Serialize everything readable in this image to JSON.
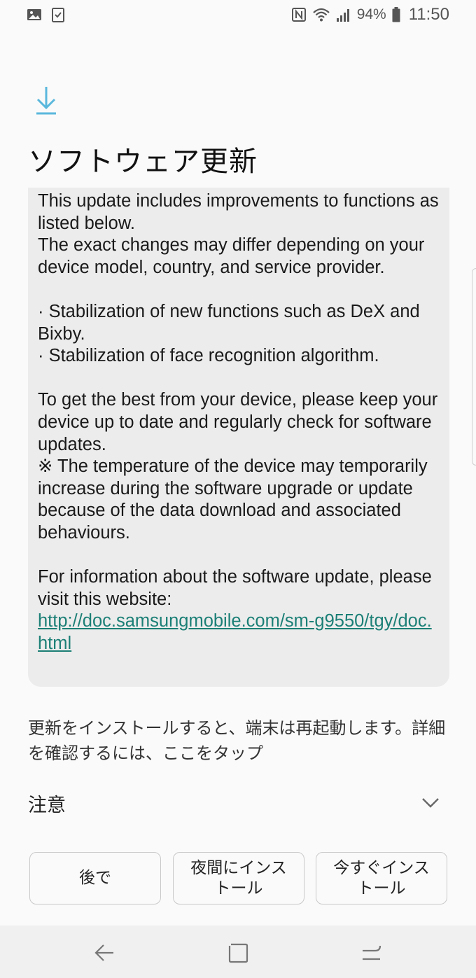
{
  "status_bar": {
    "battery_percent": "94%",
    "time": "11:50",
    "left_icons": [
      "gallery-icon",
      "checklist-icon"
    ],
    "right_icons": [
      "nfc-icon",
      "wifi-icon",
      "signal-icon",
      "battery-icon"
    ]
  },
  "header": {
    "icon": "download-icon",
    "title": "ソフトウェア更新"
  },
  "release_notes": {
    "paragraphs": [
      "This update includes improvements to functions as listed below.\nThe exact changes may differ depending on your device model, country, and service provider.",
      "· Stabilization of new functions such as DeX and Bixby.\n· Stabilization of face recognition algorithm.",
      "To get the best from your device, please keep your device up to date and regularly check for software updates.\n※ The temperature of the device may temporarily increase during the software upgrade or update because of the data download and associated behaviours.",
      "For information about the software update, please visit this website:"
    ],
    "link": "http://doc.samsungmobile.com/sm-g9550/tgy/doc.html"
  },
  "install_info": "更新をインストールすると、端末は再起動します。詳細を確認するには、ここをタップ",
  "caution": {
    "label": "注意",
    "icon": "chevron-down-icon"
  },
  "buttons": {
    "later": "後で",
    "night": "夜間にインストール",
    "now": "今すぐインストール"
  },
  "colors": {
    "accent": "#5bb8dc",
    "link": "#1b7f76",
    "card_bg": "#ececec",
    "page_bg": "#fafafa"
  }
}
